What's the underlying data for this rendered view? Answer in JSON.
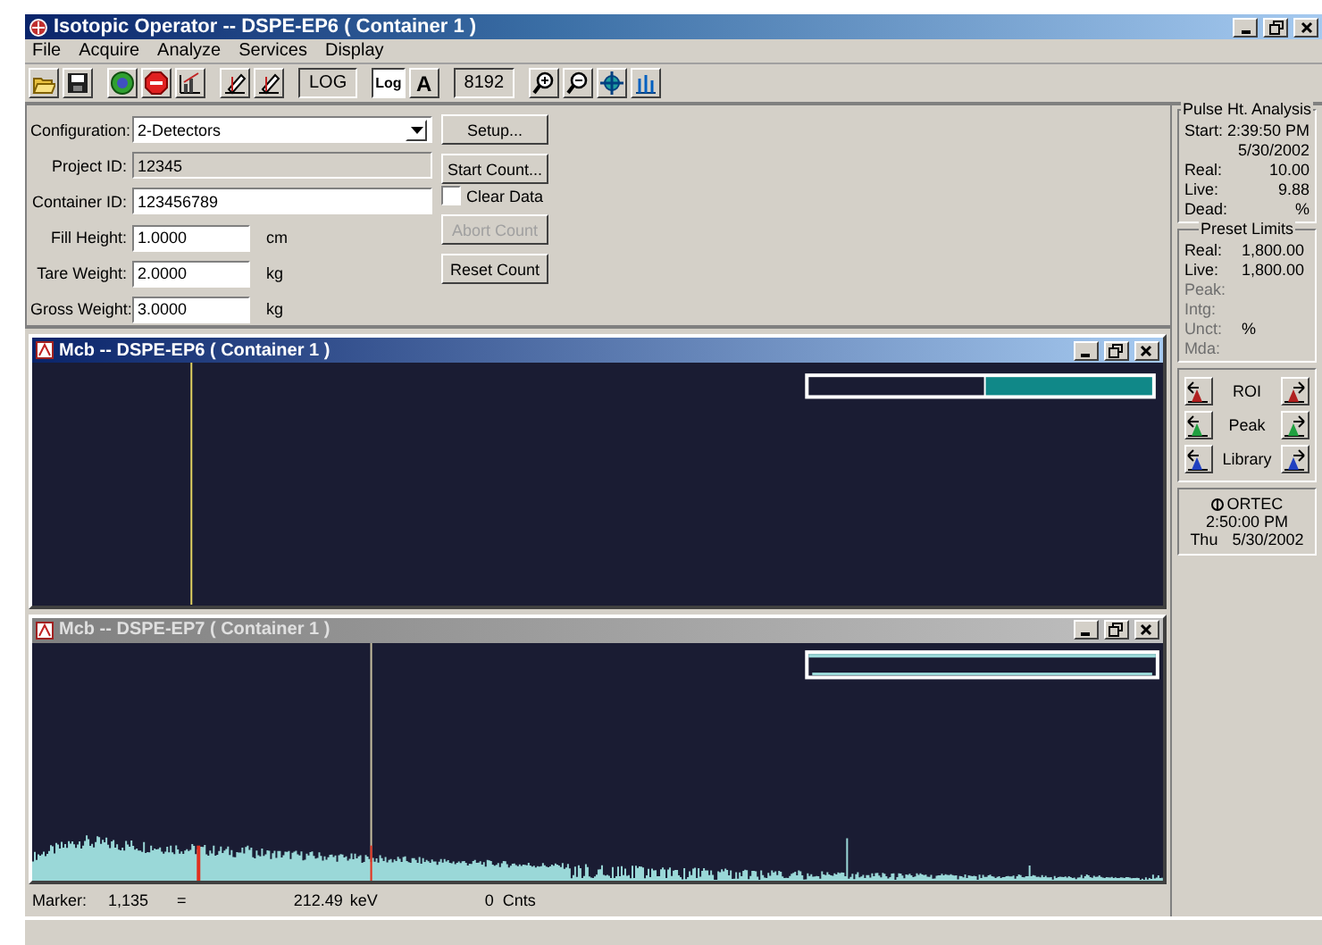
{
  "window": {
    "title": "Isotopic Operator -- DSPE-EP6 ( Container 1 )"
  },
  "menu": [
    "File",
    "Acquire",
    "Analyze",
    "Services",
    "Display"
  ],
  "toolbar": [
    {
      "kind": "open"
    },
    {
      "kind": "save"
    },
    {
      "kind": "sep"
    },
    {
      "kind": "go"
    },
    {
      "kind": "stop"
    },
    {
      "kind": "chart"
    },
    {
      "kind": "sep"
    },
    {
      "kind": "pen"
    },
    {
      "kind": "pen"
    },
    {
      "kind": "sep"
    },
    {
      "kind": "text",
      "label": "LOG"
    },
    {
      "kind": "sep"
    },
    {
      "kind": "toggle",
      "label": "Log",
      "selected": true
    },
    {
      "kind": "toggle",
      "label": "A",
      "selected": false
    },
    {
      "kind": "sep"
    },
    {
      "kind": "text",
      "label": "8192"
    },
    {
      "kind": "sep"
    },
    {
      "kind": "zoomin"
    },
    {
      "kind": "zoomout"
    },
    {
      "kind": "center"
    },
    {
      "kind": "peaks"
    }
  ],
  "form": {
    "fields": [
      {
        "label": "Configuration:",
        "value": "2-Detectors",
        "kind": "dropdown",
        "disabled": false
      },
      {
        "label": "Project ID:",
        "value": "12345",
        "kind": "wide",
        "disabled": true
      },
      {
        "label": "Container ID:",
        "value": "123456789",
        "kind": "wide",
        "disabled": false
      },
      {
        "label": "Fill Height:",
        "value": "1.0000",
        "unit": "cm",
        "kind": "short",
        "disabled": false
      },
      {
        "label": "Tare Weight:",
        "value": "2.0000",
        "unit": "kg",
        "kind": "short",
        "disabled": false
      },
      {
        "label": "Gross Weight:",
        "value": "3.0000",
        "unit": "kg",
        "kind": "short",
        "disabled": false
      }
    ],
    "buttons": [
      {
        "kind": "button",
        "label": "Setup...",
        "disabled": false
      },
      {
        "kind": "button",
        "label": "Start Count...",
        "disabled": false
      },
      {
        "kind": "checkbox",
        "label": "Clear Data",
        "checked": false
      },
      {
        "kind": "button",
        "label": "Abort Count",
        "disabled": true
      },
      {
        "kind": "button",
        "label": "Reset Count",
        "disabled": false
      }
    ]
  },
  "pulse_analysis": {
    "title": "Pulse Ht. Analysis",
    "rows": [
      {
        "label": "Start:",
        "value": "2:39:50 PM"
      },
      {
        "value": "5/30/2002"
      },
      {
        "label": "Real:",
        "value": "10.00"
      },
      {
        "label": "Live:",
        "value": "9.88"
      },
      {
        "label": "Dead:",
        "value": "%"
      }
    ]
  },
  "preset_limits": {
    "title": "Preset Limits",
    "rows": [
      {
        "label": "Real:",
        "value": "1,800.00",
        "disabled": false
      },
      {
        "label": "Live:",
        "value": "1,800.00",
        "disabled": false
      },
      {
        "label": "Peak:",
        "disabled": true
      },
      {
        "label": "Intg:",
        "disabled": true
      },
      {
        "label": "Unct:",
        "value": "%",
        "disabled": true
      },
      {
        "label": "Mda:",
        "disabled": true
      }
    ]
  },
  "navigation": [
    {
      "label": "ROI",
      "kind": "roi"
    },
    {
      "label": "Peak",
      "kind": "peak"
    },
    {
      "label": "Library",
      "kind": "library"
    }
  ],
  "clock": {
    "brand": "ORTEC",
    "time": "2:50:00 PM",
    "day": "Thu",
    "date": "5/30/2002"
  },
  "mcb_windows": [
    {
      "title": "Mcb -- DSPE-EP6 ( Container 1 )",
      "active": true,
      "has_spectrum": false
    },
    {
      "title": "Mcb -- DSPE-EP7 ( Container 1 )",
      "active": false,
      "has_spectrum": true
    }
  ],
  "marker": {
    "label": "Marker:",
    "channel": "1,135",
    "equals": "=",
    "energy": "212.49",
    "energy_unit": "keV",
    "counts": "0",
    "counts_unit": "Cnts"
  }
}
